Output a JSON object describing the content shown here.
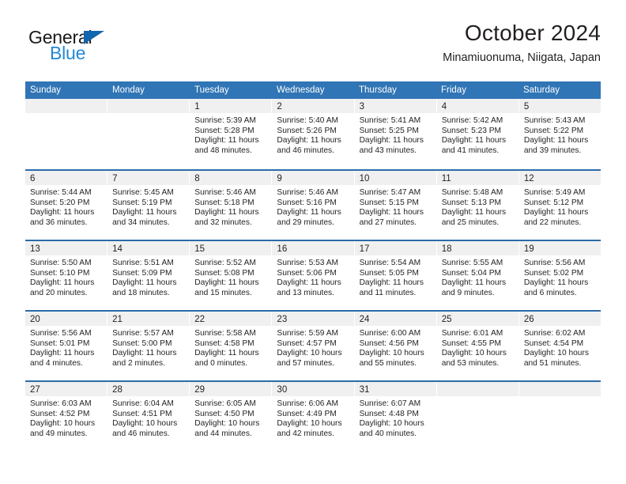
{
  "brand": {
    "name_part1": "General",
    "name_part2": "Blue",
    "triangle_icon": "triangle-icon",
    "color_dark": "#1a1a1a",
    "color_blue": "#2288d6"
  },
  "header": {
    "title": "October 2024",
    "subtitle": "Minamiuonuma, Niigata, Japan"
  },
  "colors": {
    "header_blue": "#3075b5",
    "divider_blue": "#2b6ca8",
    "daynum_band": "#f0f0f0",
    "text": "#231f20"
  },
  "weekdays": [
    "Sunday",
    "Monday",
    "Tuesday",
    "Wednesday",
    "Thursday",
    "Friday",
    "Saturday"
  ],
  "weeks": [
    [
      {
        "day": "",
        "sunrise": "",
        "sunset": "",
        "daylight1": "",
        "daylight2": ""
      },
      {
        "day": "",
        "sunrise": "",
        "sunset": "",
        "daylight1": "",
        "daylight2": ""
      },
      {
        "day": "1",
        "sunrise": "Sunrise: 5:39 AM",
        "sunset": "Sunset: 5:28 PM",
        "daylight1": "Daylight: 11 hours",
        "daylight2": "and 48 minutes."
      },
      {
        "day": "2",
        "sunrise": "Sunrise: 5:40 AM",
        "sunset": "Sunset: 5:26 PM",
        "daylight1": "Daylight: 11 hours",
        "daylight2": "and 46 minutes."
      },
      {
        "day": "3",
        "sunrise": "Sunrise: 5:41 AM",
        "sunset": "Sunset: 5:25 PM",
        "daylight1": "Daylight: 11 hours",
        "daylight2": "and 43 minutes."
      },
      {
        "day": "4",
        "sunrise": "Sunrise: 5:42 AM",
        "sunset": "Sunset: 5:23 PM",
        "daylight1": "Daylight: 11 hours",
        "daylight2": "and 41 minutes."
      },
      {
        "day": "5",
        "sunrise": "Sunrise: 5:43 AM",
        "sunset": "Sunset: 5:22 PM",
        "daylight1": "Daylight: 11 hours",
        "daylight2": "and 39 minutes."
      }
    ],
    [
      {
        "day": "6",
        "sunrise": "Sunrise: 5:44 AM",
        "sunset": "Sunset: 5:20 PM",
        "daylight1": "Daylight: 11 hours",
        "daylight2": "and 36 minutes."
      },
      {
        "day": "7",
        "sunrise": "Sunrise: 5:45 AM",
        "sunset": "Sunset: 5:19 PM",
        "daylight1": "Daylight: 11 hours",
        "daylight2": "and 34 minutes."
      },
      {
        "day": "8",
        "sunrise": "Sunrise: 5:46 AM",
        "sunset": "Sunset: 5:18 PM",
        "daylight1": "Daylight: 11 hours",
        "daylight2": "and 32 minutes."
      },
      {
        "day": "9",
        "sunrise": "Sunrise: 5:46 AM",
        "sunset": "Sunset: 5:16 PM",
        "daylight1": "Daylight: 11 hours",
        "daylight2": "and 29 minutes."
      },
      {
        "day": "10",
        "sunrise": "Sunrise: 5:47 AM",
        "sunset": "Sunset: 5:15 PM",
        "daylight1": "Daylight: 11 hours",
        "daylight2": "and 27 minutes."
      },
      {
        "day": "11",
        "sunrise": "Sunrise: 5:48 AM",
        "sunset": "Sunset: 5:13 PM",
        "daylight1": "Daylight: 11 hours",
        "daylight2": "and 25 minutes."
      },
      {
        "day": "12",
        "sunrise": "Sunrise: 5:49 AM",
        "sunset": "Sunset: 5:12 PM",
        "daylight1": "Daylight: 11 hours",
        "daylight2": "and 22 minutes."
      }
    ],
    [
      {
        "day": "13",
        "sunrise": "Sunrise: 5:50 AM",
        "sunset": "Sunset: 5:10 PM",
        "daylight1": "Daylight: 11 hours",
        "daylight2": "and 20 minutes."
      },
      {
        "day": "14",
        "sunrise": "Sunrise: 5:51 AM",
        "sunset": "Sunset: 5:09 PM",
        "daylight1": "Daylight: 11 hours",
        "daylight2": "and 18 minutes."
      },
      {
        "day": "15",
        "sunrise": "Sunrise: 5:52 AM",
        "sunset": "Sunset: 5:08 PM",
        "daylight1": "Daylight: 11 hours",
        "daylight2": "and 15 minutes."
      },
      {
        "day": "16",
        "sunrise": "Sunrise: 5:53 AM",
        "sunset": "Sunset: 5:06 PM",
        "daylight1": "Daylight: 11 hours",
        "daylight2": "and 13 minutes."
      },
      {
        "day": "17",
        "sunrise": "Sunrise: 5:54 AM",
        "sunset": "Sunset: 5:05 PM",
        "daylight1": "Daylight: 11 hours",
        "daylight2": "and 11 minutes."
      },
      {
        "day": "18",
        "sunrise": "Sunrise: 5:55 AM",
        "sunset": "Sunset: 5:04 PM",
        "daylight1": "Daylight: 11 hours",
        "daylight2": "and 9 minutes."
      },
      {
        "day": "19",
        "sunrise": "Sunrise: 5:56 AM",
        "sunset": "Sunset: 5:02 PM",
        "daylight1": "Daylight: 11 hours",
        "daylight2": "and 6 minutes."
      }
    ],
    [
      {
        "day": "20",
        "sunrise": "Sunrise: 5:56 AM",
        "sunset": "Sunset: 5:01 PM",
        "daylight1": "Daylight: 11 hours",
        "daylight2": "and 4 minutes."
      },
      {
        "day": "21",
        "sunrise": "Sunrise: 5:57 AM",
        "sunset": "Sunset: 5:00 PM",
        "daylight1": "Daylight: 11 hours",
        "daylight2": "and 2 minutes."
      },
      {
        "day": "22",
        "sunrise": "Sunrise: 5:58 AM",
        "sunset": "Sunset: 4:58 PM",
        "daylight1": "Daylight: 11 hours",
        "daylight2": "and 0 minutes."
      },
      {
        "day": "23",
        "sunrise": "Sunrise: 5:59 AM",
        "sunset": "Sunset: 4:57 PM",
        "daylight1": "Daylight: 10 hours",
        "daylight2": "and 57 minutes."
      },
      {
        "day": "24",
        "sunrise": "Sunrise: 6:00 AM",
        "sunset": "Sunset: 4:56 PM",
        "daylight1": "Daylight: 10 hours",
        "daylight2": "and 55 minutes."
      },
      {
        "day": "25",
        "sunrise": "Sunrise: 6:01 AM",
        "sunset": "Sunset: 4:55 PM",
        "daylight1": "Daylight: 10 hours",
        "daylight2": "and 53 minutes."
      },
      {
        "day": "26",
        "sunrise": "Sunrise: 6:02 AM",
        "sunset": "Sunset: 4:54 PM",
        "daylight1": "Daylight: 10 hours",
        "daylight2": "and 51 minutes."
      }
    ],
    [
      {
        "day": "27",
        "sunrise": "Sunrise: 6:03 AM",
        "sunset": "Sunset: 4:52 PM",
        "daylight1": "Daylight: 10 hours",
        "daylight2": "and 49 minutes."
      },
      {
        "day": "28",
        "sunrise": "Sunrise: 6:04 AM",
        "sunset": "Sunset: 4:51 PM",
        "daylight1": "Daylight: 10 hours",
        "daylight2": "and 46 minutes."
      },
      {
        "day": "29",
        "sunrise": "Sunrise: 6:05 AM",
        "sunset": "Sunset: 4:50 PM",
        "daylight1": "Daylight: 10 hours",
        "daylight2": "and 44 minutes."
      },
      {
        "day": "30",
        "sunrise": "Sunrise: 6:06 AM",
        "sunset": "Sunset: 4:49 PM",
        "daylight1": "Daylight: 10 hours",
        "daylight2": "and 42 minutes."
      },
      {
        "day": "31",
        "sunrise": "Sunrise: 6:07 AM",
        "sunset": "Sunset: 4:48 PM",
        "daylight1": "Daylight: 10 hours",
        "daylight2": "and 40 minutes."
      },
      {
        "day": "",
        "sunrise": "",
        "sunset": "",
        "daylight1": "",
        "daylight2": ""
      },
      {
        "day": "",
        "sunrise": "",
        "sunset": "",
        "daylight1": "",
        "daylight2": ""
      }
    ]
  ]
}
